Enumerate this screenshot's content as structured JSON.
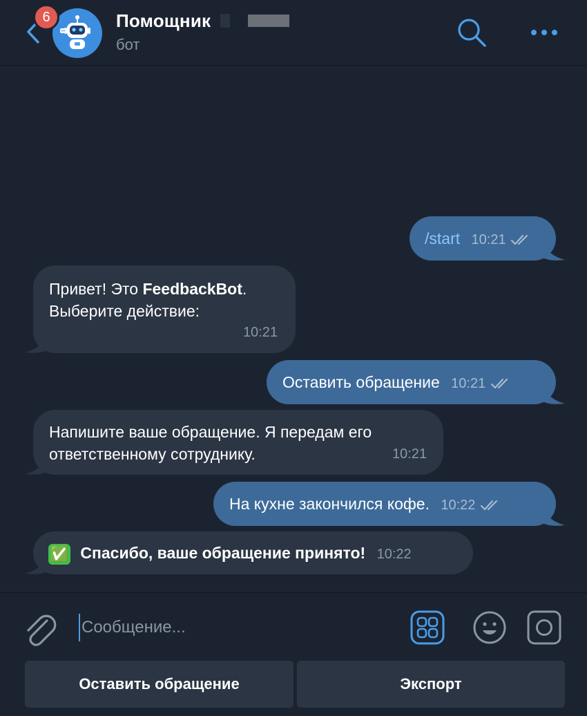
{
  "header": {
    "back_label": "back",
    "unread_count": "6",
    "title": "Помощник",
    "subtitle": "бот",
    "avatar_icon": "robot-icon",
    "accent": "#4a9de8"
  },
  "messages": [
    {
      "direction": "out",
      "text": "/start",
      "time": "10:21",
      "status": "read"
    },
    {
      "direction": "in",
      "text_line1_a": "Привет! Это ",
      "text_line1_bold": "FeedbackBot",
      "text_line1_b": ".",
      "text_line2": "Выберите действие:",
      "time": "10:21"
    },
    {
      "direction": "out",
      "text": "Оставить обращение",
      "time": "10:21",
      "status": "read"
    },
    {
      "direction": "in",
      "text_line1": "Напишите ваше обращение. Я передам его",
      "text_line2": "ответственному сотруднику.",
      "time": "10:21"
    },
    {
      "direction": "out",
      "text": "На кухне закончился кофе.",
      "time": "10:22",
      "status": "read"
    },
    {
      "direction": "in",
      "emoji": "✅",
      "text": "Спасибо, ваше обращение принято!",
      "time": "10:22"
    }
  ],
  "composer": {
    "placeholder": "Сообщение...",
    "icons": [
      "paperclip-icon",
      "bot-menu-icon",
      "emoji-icon",
      "camera-icon"
    ]
  },
  "keyboard": {
    "buttons": [
      {
        "label": "Оставить обращение"
      },
      {
        "label": "Экспорт"
      }
    ]
  },
  "colors": {
    "background": "#1c2330",
    "outgoing_bubble": "#3d6a99",
    "incoming_bubble": "#2b3543",
    "badge": "#e15a54"
  }
}
